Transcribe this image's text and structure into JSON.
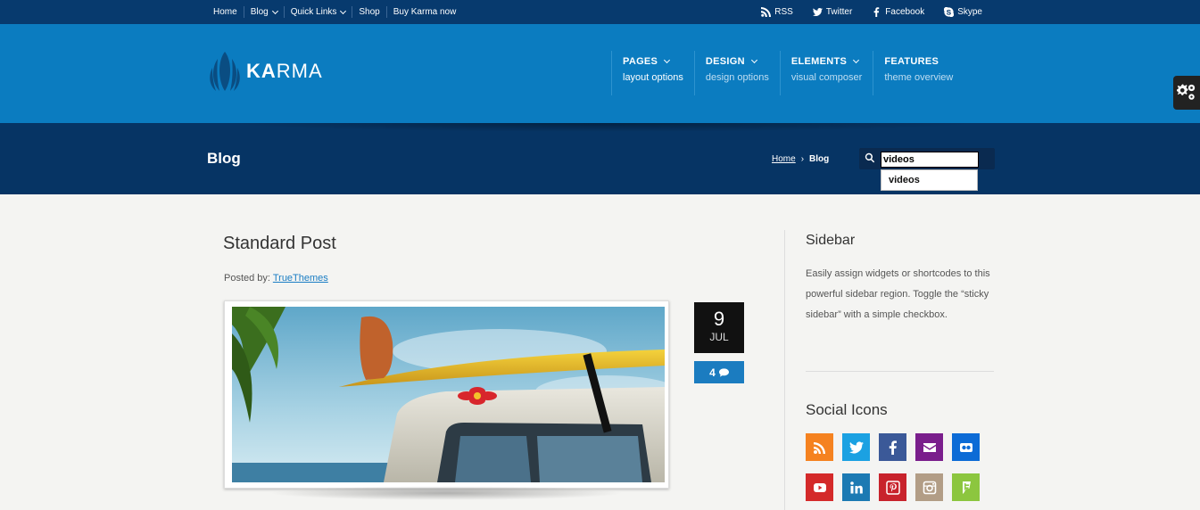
{
  "topbar": {
    "nav": [
      {
        "label": "Home",
        "dropdown": false
      },
      {
        "label": "Blog",
        "dropdown": true
      },
      {
        "label": "Quick Links",
        "dropdown": true
      },
      {
        "label": "Shop",
        "dropdown": false
      },
      {
        "label": "Buy Karma now",
        "dropdown": false
      }
    ],
    "social": [
      {
        "label": "RSS",
        "icon": "rss-icon"
      },
      {
        "label": "Twitter",
        "icon": "twitter-icon"
      },
      {
        "label": "Facebook",
        "icon": "facebook-icon"
      },
      {
        "label": "Skype",
        "icon": "skype-icon"
      }
    ]
  },
  "header": {
    "logo_bold": "KA",
    "logo_rest": "RMA",
    "menu": [
      {
        "title": "PAGES",
        "sub": "layout options",
        "dropdown": true
      },
      {
        "title": "DESIGN",
        "sub": "design options",
        "dropdown": true
      },
      {
        "title": "ELEMENTS",
        "sub": "visual composer",
        "dropdown": true
      },
      {
        "title": "FEATURES",
        "sub": "theme overview",
        "dropdown": false
      }
    ]
  },
  "band": {
    "title": "Blog",
    "breadcrumb_home": "Home",
    "breadcrumb_current": "Blog",
    "search_value": "videos",
    "suggestion": "videos"
  },
  "post": {
    "title": "Standard Post",
    "posted_by_label": "Posted by:",
    "author": "TrueThemes",
    "day": "9",
    "month": "JUL",
    "comments": "4"
  },
  "sidebar": {
    "title": "Sidebar",
    "text": "Easily assign widgets or shortcodes to this powerful sidebar region. Toggle the “sticky sidebar” with a simple checkbox.",
    "social_title": "Social Icons",
    "social_icons": [
      {
        "name": "rss-icon",
        "color": "#f58220"
      },
      {
        "name": "twitter-icon",
        "color": "#1ba1e2"
      },
      {
        "name": "facebook-icon",
        "color": "#3b5998"
      },
      {
        "name": "email-icon",
        "color": "#7a1e8c"
      },
      {
        "name": "flickr-icon",
        "color": "#0c6bd6"
      },
      {
        "name": "youtube-icon",
        "color": "#d42a2a"
      },
      {
        "name": "linkedin-icon",
        "color": "#1c7ab3"
      },
      {
        "name": "pinterest-icon",
        "color": "#c8232c"
      },
      {
        "name": "instagram-icon",
        "color": "#b29d86"
      },
      {
        "name": "foursquare-icon",
        "color": "#8cc63f"
      }
    ]
  },
  "colors": {
    "topbar": "#073a6e",
    "header": "#0b7cc0",
    "band": "#063464",
    "accent": "#1b7cc0"
  }
}
